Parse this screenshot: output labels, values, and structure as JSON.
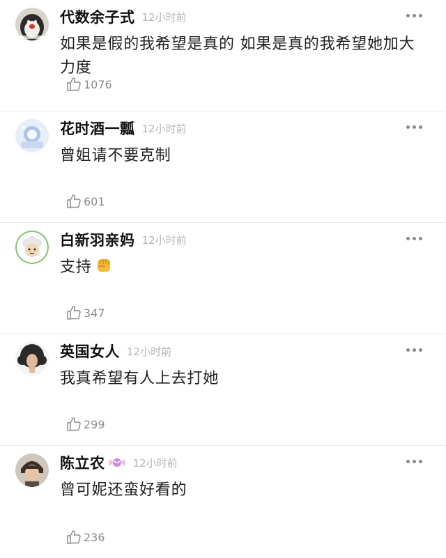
{
  "comments": [
    {
      "name": "代数余子式",
      "time": "12小时前",
      "text": "如果是假的我希望是真的 如果是真的我希望她加大力度",
      "likes": "1076",
      "avatar": "penguin-avatar",
      "accent": "#c63b2e"
    },
    {
      "name": "花时酒一瓢",
      "time": "12小时前",
      "text": "曾姐请不要克制",
      "likes": "601",
      "avatar": "snowy-avatar",
      "accent": "#a9c4e8"
    },
    {
      "name": "白新羽亲妈",
      "time": "12小时前",
      "text": "支持",
      "emoji": "raised-fist-emoji",
      "likes": "347",
      "avatar": "cartoon-sheep-avatar",
      "accent": "#7fc46a"
    },
    {
      "name": "英国女人",
      "time": "12小时前",
      "text": "我真希望有人上去打她",
      "likes": "299",
      "avatar": "curly-hair-avatar",
      "accent": "#2a2a2a"
    },
    {
      "name": "陈立农",
      "badge": "candy-badge-icon",
      "time": "12小时前",
      "text": "曾可妮还蛮好看的",
      "likes": "236",
      "avatar": "portrait-avatar",
      "accent": "#5a4a40"
    }
  ],
  "icons": {
    "more": "more-dots-icon",
    "like": "thumbs-up-icon"
  }
}
